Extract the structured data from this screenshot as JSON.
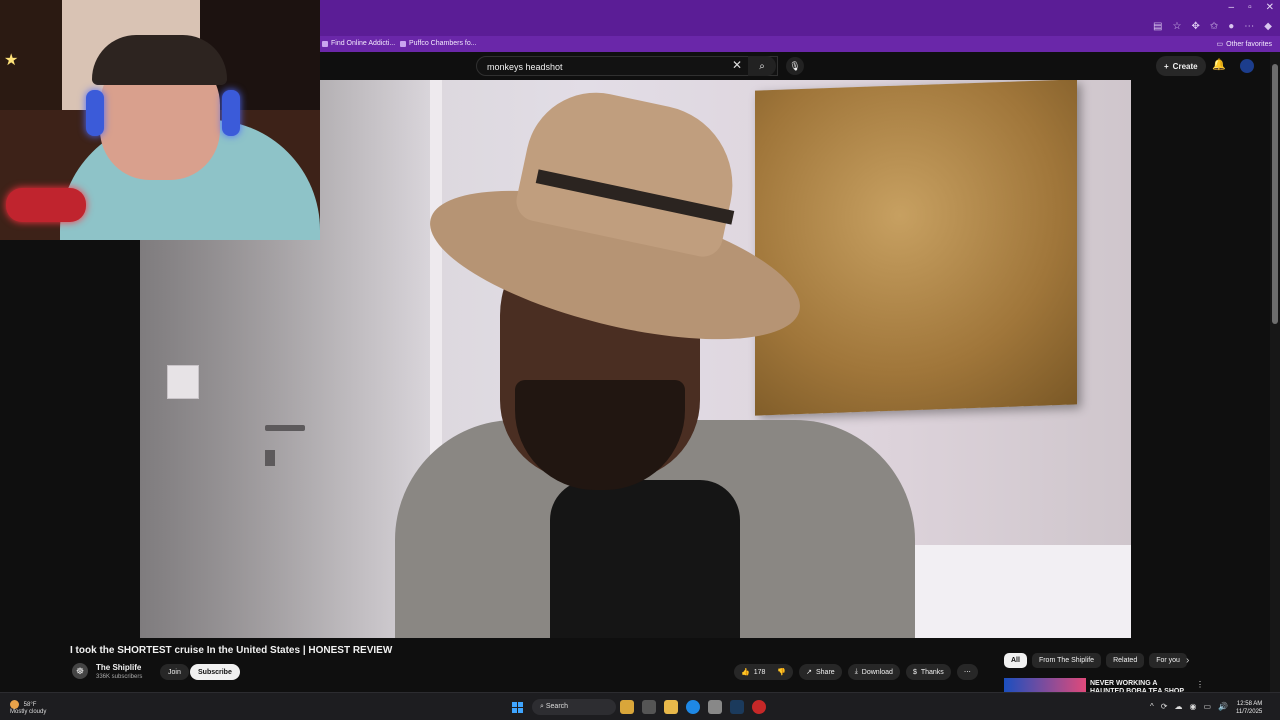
{
  "window": {
    "controls": [
      "–",
      "▫",
      "✕"
    ]
  },
  "bookmarks": {
    "items": [
      {
        "label": "Find Online Addicti..."
      },
      {
        "label": "Puffco Chambers fo..."
      }
    ],
    "other_favorites": "Other favorites"
  },
  "youtube": {
    "search": {
      "value": "monkeys headshot"
    },
    "create_label": "Create"
  },
  "video": {
    "title": "I took the SHORTEST cruise In the United States | HONEST REVIEW",
    "channel_name": "The Shiplife",
    "subscribers": "336K subscribers",
    "join_label": "Join",
    "subscribe_label": "Subscribe",
    "like_count": "178",
    "share_label": "Share",
    "download_label": "Download",
    "thanks_label": "Thanks"
  },
  "sidebar": {
    "chips": [
      {
        "label": "All"
      },
      {
        "label": "From The Shiplife"
      },
      {
        "label": "Related"
      },
      {
        "label": "For you"
      }
    ],
    "rec_title": "NEVER WORKING A HAUNTED BOBA TEA SHOP AGAIN!!"
  },
  "taskbar": {
    "weather_temp": "58°F",
    "weather_desc": "Mostly cloudy",
    "search_label": "Search",
    "time": "12:58 AM",
    "date": "11/7/2025"
  },
  "colors": {
    "browser_chrome": "#5b1d96",
    "youtube_bg": "#0f0f0f",
    "taskbar": "#1d1d20"
  }
}
